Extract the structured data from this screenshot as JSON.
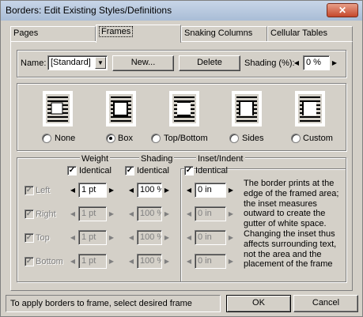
{
  "window": {
    "title": "Borders: Edit Existing Styles/Definitions",
    "close_glyph": "✕"
  },
  "tabs": [
    {
      "label": "Pages"
    },
    {
      "label": "Frames"
    },
    {
      "label": "Snaking Columns"
    },
    {
      "label": "Cellular Tables"
    }
  ],
  "style_row": {
    "name_label": "Name:",
    "name_value": "[Standard]",
    "new_button": "New...",
    "delete_button": "Delete",
    "shading_label": "Shading (%):",
    "shading_value": "0 %"
  },
  "border_options": [
    {
      "label": "None",
      "selected": false
    },
    {
      "label": "Box",
      "selected": true
    },
    {
      "label": "Top/Bottom",
      "selected": false
    },
    {
      "label": "Sides",
      "selected": false
    },
    {
      "label": "Custom",
      "selected": false
    }
  ],
  "grid": {
    "weight_header": "Weight",
    "shading_header": "Shading",
    "inset_header": "Inset/Indent",
    "identical_label": "Identical",
    "rows": [
      {
        "label": "Left",
        "enabled": true,
        "weight": "1 pt",
        "shading": "100 %",
        "inset": "0 in"
      },
      {
        "label": "Right",
        "enabled": false,
        "weight": "1 pt",
        "shading": "100 %",
        "inset": "0 in"
      },
      {
        "label": "Top",
        "enabled": false,
        "weight": "1 pt",
        "shading": "100 %",
        "inset": "0 in"
      },
      {
        "label": "Bottom",
        "enabled": false,
        "weight": "1 pt",
        "shading": "100 %",
        "inset": "0 in"
      }
    ]
  },
  "description": "The border prints at the edge of the framed area; the inset measures outward to create the gutter of white space. Changing the inset thus affects surrounding text, not the area and the placement of the frame",
  "status": "To apply borders to frame, select desired frame",
  "ok_button": "OK",
  "cancel_button": "Cancel"
}
